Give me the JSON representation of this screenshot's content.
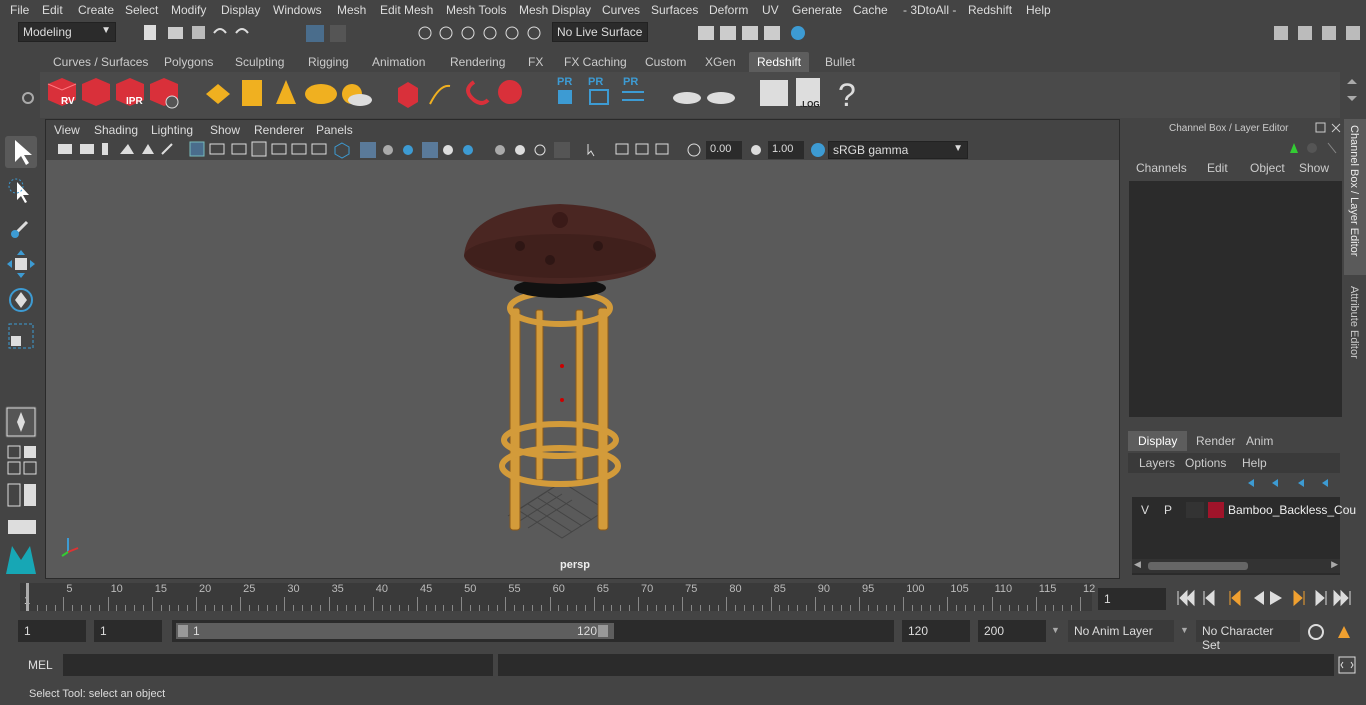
{
  "menubar": {
    "items": [
      "File",
      "Edit",
      "Create",
      "Select",
      "Modify",
      "Display",
      "Windows",
      "Mesh",
      "Edit Mesh",
      "Mesh Tools",
      "Mesh Display",
      "Curves",
      "Surfaces",
      "Deform",
      "UV",
      "Generate",
      "Cache",
      "- 3DtoAll -",
      "Redshift",
      "Help"
    ]
  },
  "status": {
    "mode": "Modeling",
    "live_surface": "No Live Surface"
  },
  "shelf": {
    "tabs": [
      "Curves / Surfaces",
      "Polygons",
      "Sculpting",
      "Rigging",
      "Animation",
      "Rendering",
      "FX",
      "FX Caching",
      "Custom",
      "XGen",
      "Redshift",
      "Bullet"
    ],
    "active_tab": "Redshift",
    "button_labels": [
      "RV",
      "IPR",
      "PR",
      "PR",
      "PR",
      ".LOG",
      "?"
    ]
  },
  "viewport": {
    "menu": [
      "View",
      "Shading",
      "Lighting",
      "Show",
      "Renderer",
      "Panels"
    ],
    "exposure": "0.00",
    "gamma": "1.00",
    "color_space": "sRGB gamma",
    "camera_label": "persp"
  },
  "channel_box": {
    "title": "Channel Box / Layer Editor",
    "menu": [
      "Channels",
      "Edit",
      "Object",
      "Show"
    ],
    "layer_tabs": [
      "Display",
      "Render",
      "Anim"
    ],
    "layer_active_tab": "Display",
    "layer_menu": [
      "Options",
      "Help"
    ],
    "layers_label": "Layers",
    "layer_row": {
      "v": "V",
      "p": "P",
      "name": "Bamboo_Backless_Cou",
      "color": "#a0142a"
    }
  },
  "side_tabs": [
    "Channel Box / Layer Editor",
    "Attribute Editor"
  ],
  "timeline": {
    "ticks": [
      "5",
      "10",
      "15",
      "20",
      "25",
      "30",
      "35",
      "40",
      "45",
      "50",
      "55",
      "60",
      "65",
      "70",
      "75",
      "80",
      "85",
      "90",
      "95",
      "100",
      "105",
      "110",
      "115",
      "12"
    ],
    "start_mark": "1",
    "current_frame": "1"
  },
  "range": {
    "start": "1",
    "playback_start": "1",
    "slider_start": "1",
    "slider_end": "120",
    "end": "120",
    "max_end": "200",
    "anim_layer": "No Anim Layer",
    "character_set": "No Character Set"
  },
  "command": {
    "lang": "MEL"
  },
  "help": {
    "text": "Select Tool: select an object"
  },
  "colors": {
    "accent": "#5a9fd4",
    "shelf_red": "#d9303a",
    "shelf_yellow": "#f0b020"
  }
}
